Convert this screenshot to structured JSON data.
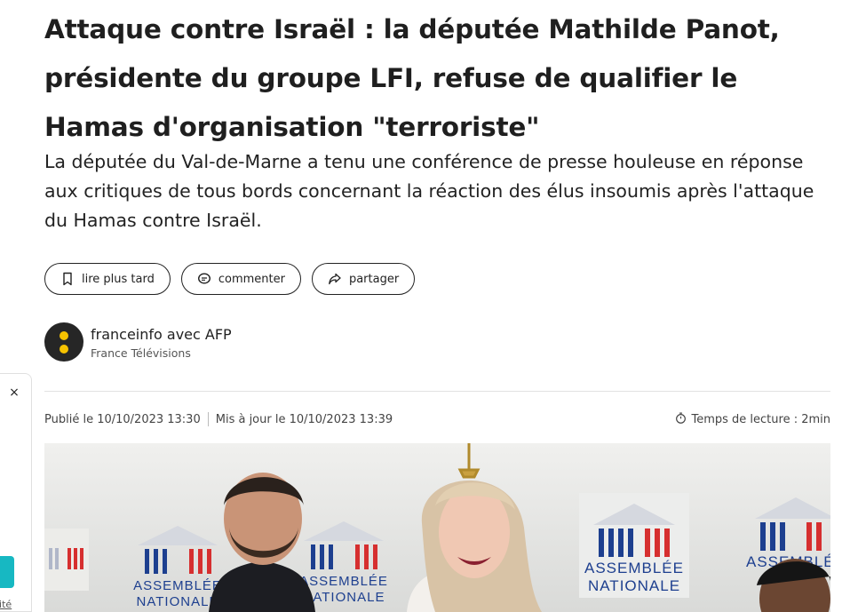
{
  "article": {
    "title": "Attaque contre Israël : la députée Mathilde Panot, présidente du groupe LFI, refuse de qualifier le Hamas d'organisation \"terroriste\"",
    "lede": "La députée du Val-de-Marne a tenu une conférence de presse houleuse en réponse aux critiques de tous bords concernant la réaction des élus insoumis après l'attaque du Hamas contre Israël."
  },
  "actions": {
    "read_later": "lire plus tard",
    "comment": "commenter",
    "share": "partager"
  },
  "author": {
    "name": "franceinfo avec AFP",
    "org": "France Télévisions"
  },
  "meta": {
    "published": "Publié le 10/10/2023 13:30",
    "updated": "Mis à jour le 10/10/2023 13:39",
    "reading_time": "Temps de lecture : 2min"
  },
  "photo": {
    "banner_line1": "ASSEMBLÉE",
    "banner_line2": "NATIONALE"
  },
  "side_panel": {
    "close": "×",
    "partial_text": "lité"
  }
}
